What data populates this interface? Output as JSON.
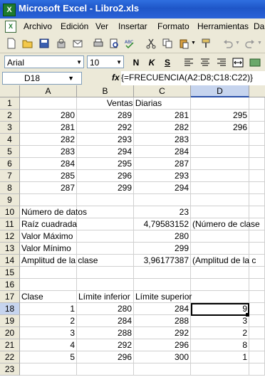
{
  "window": {
    "title": "Microsoft Excel - Libro2.xls"
  },
  "menu": [
    "Archivo",
    "Edición",
    "Ver",
    "Insertar",
    "Formato",
    "Herramientas",
    "Da"
  ],
  "formatbar": {
    "font": "Arial",
    "size": "10",
    "bold": "N",
    "italic": "K",
    "underline": "S"
  },
  "formula_bar": {
    "name_box": "D18",
    "fx": "fx",
    "formula": "{=FRECUENCIA(A2:D8;C18:C22)}"
  },
  "columns": [
    "A",
    "B",
    "C",
    "D"
  ],
  "rows": [
    "1",
    "2",
    "3",
    "4",
    "5",
    "6",
    "7",
    "8",
    "9",
    "10",
    "11",
    "12",
    "13",
    "14",
    "15",
    "16",
    "17",
    "18",
    "19",
    "20",
    "21",
    "22",
    "23"
  ],
  "sheet": {
    "title": "Ventas Diarias",
    "ventas": [
      [
        "280",
        "289",
        "281",
        "295"
      ],
      [
        "281",
        "292",
        "282",
        "296"
      ],
      [
        "282",
        "293",
        "283",
        ""
      ],
      [
        "283",
        "294",
        "284",
        ""
      ],
      [
        "284",
        "295",
        "287",
        ""
      ],
      [
        "285",
        "296",
        "293",
        ""
      ],
      [
        "287",
        "299",
        "294",
        ""
      ]
    ],
    "stats": [
      {
        "label": "Número de datos",
        "value": "23",
        "note": ""
      },
      {
        "label": "Raíz cuadrada",
        "value": "4,79583152",
        "note": "(Número de clase"
      },
      {
        "label": "Valor Máximo",
        "value": "280",
        "note": ""
      },
      {
        "label": "Valor Mínimo",
        "value": "299",
        "note": ""
      },
      {
        "label": "Amplitud de la clase",
        "value": "3,96177387",
        "note": "(Amplitud de la c"
      }
    ],
    "class_headers": [
      "Clase",
      "Límite inferior",
      "Límite superior"
    ],
    "classes": [
      [
        "1",
        "280",
        "284",
        "9"
      ],
      [
        "2",
        "284",
        "288",
        "3"
      ],
      [
        "3",
        "288",
        "292",
        "2"
      ],
      [
        "4",
        "292",
        "296",
        "8"
      ],
      [
        "5",
        "296",
        "300",
        "1"
      ]
    ]
  }
}
